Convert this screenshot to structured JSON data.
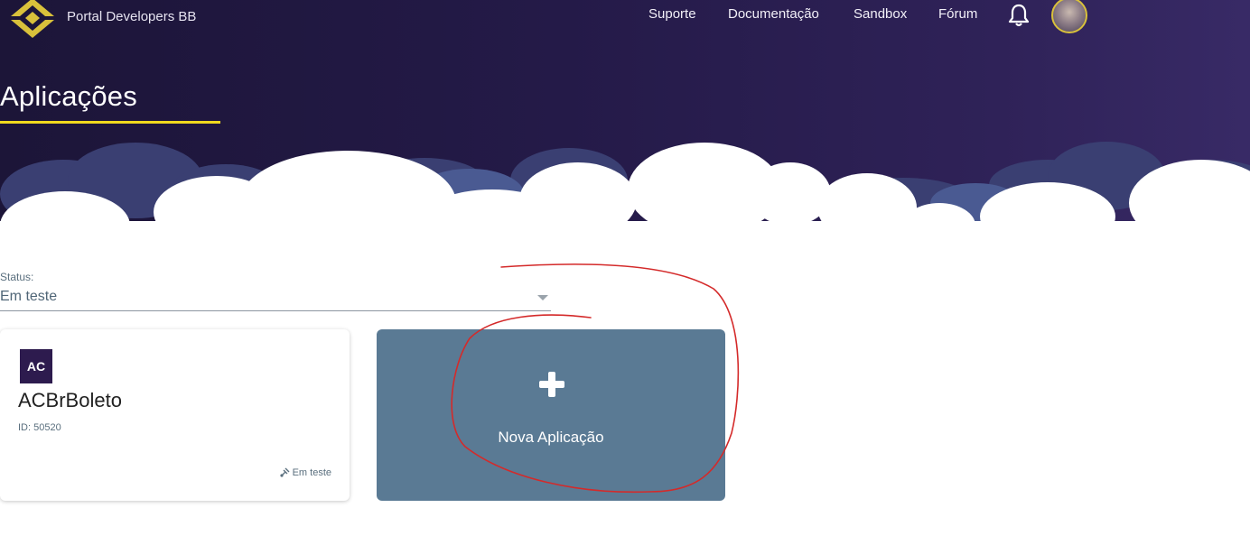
{
  "header": {
    "brand": "Portal Developers BB",
    "nav": [
      "Suporte",
      "Documentação",
      "Sandbox",
      "Fórum"
    ],
    "accent": "#f0d91e",
    "bg": "#241a48"
  },
  "page": {
    "title": "Aplicações"
  },
  "filter": {
    "label": "Status:",
    "value": "Em teste"
  },
  "apps": [
    {
      "initials": "AC",
      "name": "ACBrBoleto",
      "id": "ID: 50520",
      "status": "Em teste"
    }
  ],
  "new_app": {
    "label": "Nova Aplicação",
    "color": "#5a7a94"
  },
  "icons": {
    "bell": "bell-icon",
    "plus": "plus-icon",
    "status": "flask-icon",
    "logo": "bb-logo-icon"
  }
}
